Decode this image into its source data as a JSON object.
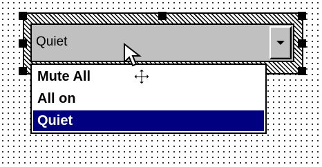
{
  "combo": {
    "value": "Quiet"
  },
  "dropdown": {
    "items": [
      {
        "label": "Mute All",
        "selected": false
      },
      {
        "label": "All on",
        "selected": false
      },
      {
        "label": "Quiet",
        "selected": true
      }
    ]
  },
  "icons": {
    "dropdown_arrow": "chevron-down-icon",
    "pointer": "arrow-cursor-icon",
    "move": "move-cursor-icon"
  },
  "colors": {
    "selection_highlight": "#000080",
    "combo_background": "#c0c0c0"
  }
}
